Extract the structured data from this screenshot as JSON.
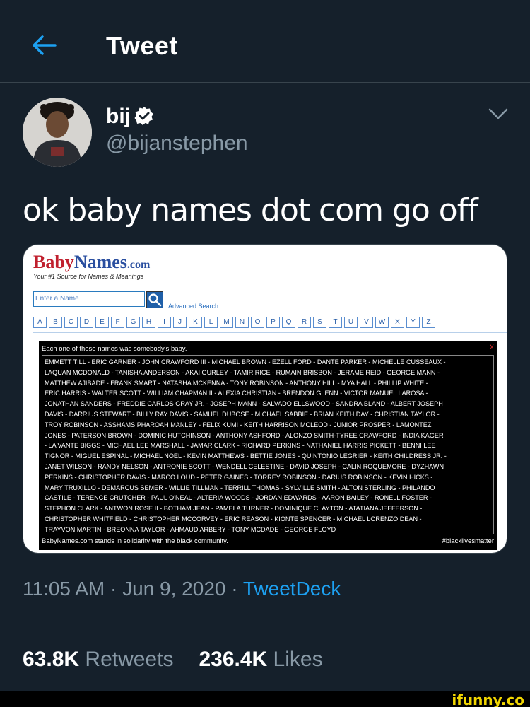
{
  "header": {
    "title": "Tweet",
    "back_icon": "arrow-left-icon"
  },
  "author": {
    "name": "bij",
    "handle": "@bijanstephen",
    "verified_icon": "verified-badge-icon"
  },
  "tweet": {
    "text": "ok baby names dot com go off"
  },
  "card": {
    "logo": {
      "baby": "Baby",
      "names": "Names",
      "com": ".com"
    },
    "tagline": "Your #1 Source for Names & Meanings",
    "search_placeholder": "Enter a Name",
    "advanced_search": "Advanced Search",
    "letters": [
      "A",
      "B",
      "C",
      "D",
      "E",
      "F",
      "G",
      "H",
      "I",
      "J",
      "K",
      "L",
      "M",
      "N",
      "O",
      "P",
      "Q",
      "R",
      "S",
      "T",
      "U",
      "V",
      "W",
      "X",
      "Y",
      "Z"
    ],
    "banner": {
      "heading": "Each one of these names was somebody's baby.",
      "close": "X",
      "names_lines": [
        "EMMETT TILL - ERIC GARNER - JOHN CRAWFORD III - MICHAEL BROWN - EZELL FORD - DANTE PARKER - MICHELLE CUSSEAUX -",
        "LAQUAN MCDONALD - TANISHA ANDERSON - AKAI GURLEY - TAMIR RICE - RUMAIN BRISBON - JERAME REID - GEORGE MANN -",
        "MATTHEW AJIBADE - FRANK SMART - NATASHA MCKENNA - TONY ROBINSON - ANTHONY HILL - MYA HALL - PHILLIP WHITE -",
        "ERIC HARRIS - WALTER SCOTT - WILLIAM CHAPMAN II - ALEXIA CHRISTIAN - BRENDON GLENN - VICTOR MANUEL LAROSA -",
        "JONATHAN SANDERS - FREDDIE CARLOS GRAY JR. - JOSEPH MANN - SALVADO ELLSWOOD - SANDRA BLAND - ALBERT JOSEPH",
        "DAVIS - DARRIUS STEWART - BILLY RAY DAVIS - SAMUEL DUBOSE - MICHAEL SABBIE - BRIAN KEITH DAY - CHRISTIAN TAYLOR -",
        "TROY ROBINSON - ASSHAMS PHAROAH MANLEY - FELIX KUMI - KEITH HARRISON MCLEOD - JUNIOR PROSPER - LAMONTEZ",
        "JONES - PATERSON BROWN - DOMINIC HUTCHINSON - ANTHONY ASHFORD - ALONZO SMITH-TYREE CRAWFORD - INDIA KAGER",
        "- LA'VANTE BIGGS - MICHAEL LEE MARSHALL - JAMAR CLARK - RICHARD PERKINS - NATHANIEL HARRIS PICKETT - BENNI LEE",
        "TIGNOR - MIGUEL ESPINAL - MICHAEL NOEL - KEVIN MATTHEWS - BETTIE JONES - QUINTONIO LEGRIER - KEITH CHILDRESS JR. -",
        "JANET WILSON - RANDY NELSON - ANTRONIE SCOTT - WENDELL CELESTINE - DAVID JOSEPH - CALIN ROQUEMORE - DYZHAWN",
        "PERKINS - CHRISTOPHER DAVIS - MARCO LOUD - PETER GAINES - TORREY ROBINSON - DARIUS ROBINSON - KEVIN HICKS -",
        "MARY TRUXILLO - DEMARCUS SEMER - WILLIE TILLMAN - TERRILL THOMAS - SYLVILLE SMITH - ALTON STERLING - PHILANDO",
        "CASTILE - TERENCE CRUTCHER - PAUL O'NEAL - ALTERIA WOODS - JORDAN EDWARDS - AARON BAILEY - RONELL FOSTER -",
        "STEPHON CLARK - ANTWON ROSE II - BOTHAM JEAN - PAMELA TURNER - DOMINIQUE CLAYTON - ATATIANA JEFFERSON -",
        "CHRISTOPHER WHITFIELD - CHRISTOPHER MCCORVEY - ERIC REASON - KIONTE SPENCER - MICHAEL LORENZO DEAN -",
        "TRAYVON MARTIN - BREONNA TAYLOR - AHMAUD ARBERY - TONY MCDADE - GEORGE FLOYD"
      ],
      "footer": "BabyNames.com stands in solidarity with the black community.",
      "hashtag": "#blacklivesmatter"
    }
  },
  "meta": {
    "time": "11:05 AM",
    "sep1": " · ",
    "date": "Jun 9, 2020",
    "sep2": " · ",
    "source": "TweetDeck"
  },
  "stats": {
    "retweets_count": "63.8K",
    "retweets_label": " Retweets",
    "likes_count": "236.4K",
    "likes_label": " Likes"
  },
  "watermark": "ifunny.co",
  "colors": {
    "background": "#15202b",
    "accent": "#1da1f2",
    "secondary_text": "#8899a6",
    "divider": "#38444d"
  }
}
